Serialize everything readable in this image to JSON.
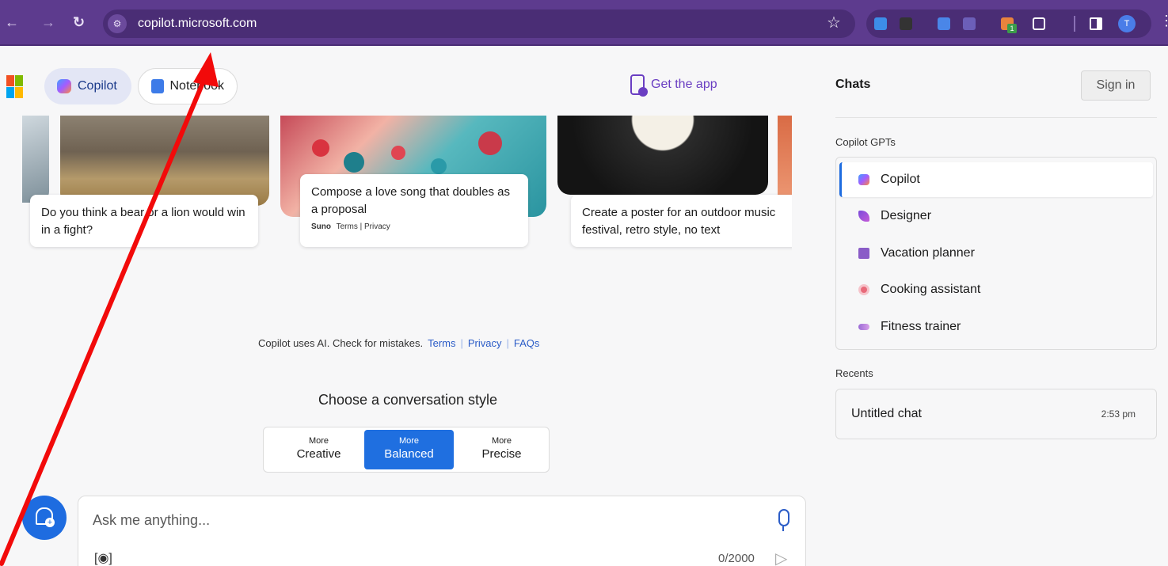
{
  "browser": {
    "url": "copilot.microsoft.com",
    "profile_initial": "T",
    "extension_badge": "1",
    "colors": {
      "frame": "#5d3b8e",
      "omnibox": "#4a2d75"
    }
  },
  "header": {
    "tabs": [
      {
        "label": "Copilot",
        "icon": "copilot-icon",
        "active": true
      },
      {
        "label": "Notebook",
        "icon": "notebook-icon",
        "active": false
      }
    ],
    "get_app": "Get the app"
  },
  "cards": [
    {
      "text": "Do you think a bear or a lion would win in a fight?"
    },
    {
      "text": "Compose a love song that doubles as a proposal",
      "attribution_brand": "Suno",
      "attribution_links": "Terms | Privacy"
    },
    {
      "text": "Create a poster for an outdoor music festival, retro style, no text"
    }
  ],
  "disclaimer": {
    "text": "Copilot uses AI. Check for mistakes.",
    "links": [
      "Terms",
      "Privacy",
      "FAQs"
    ]
  },
  "conversation_style": {
    "title": "Choose a conversation style",
    "options": [
      {
        "top": "More",
        "label": "Creative",
        "active": false
      },
      {
        "top": "More",
        "label": "Balanced",
        "active": true
      },
      {
        "top": "More",
        "label": "Precise",
        "active": false
      }
    ],
    "accent": "#1f6fe0"
  },
  "input": {
    "placeholder": "Ask me anything...",
    "counter": "0/2000"
  },
  "sidebar": {
    "title": "Chats",
    "sign_in": "Sign in",
    "gpts_label": "Copilot GPTs",
    "gpts": [
      {
        "label": "Copilot",
        "icon": "copilot-icon",
        "active": true
      },
      {
        "label": "Designer",
        "icon": "designer-icon",
        "active": false
      },
      {
        "label": "Vacation planner",
        "icon": "suitcase-icon",
        "active": false
      },
      {
        "label": "Cooking assistant",
        "icon": "cooking-icon",
        "active": false
      },
      {
        "label": "Fitness trainer",
        "icon": "dumbbell-icon",
        "active": false
      }
    ],
    "recents_label": "Recents",
    "recents": [
      {
        "title": "Untitled chat",
        "time": "2:53 pm"
      }
    ]
  }
}
